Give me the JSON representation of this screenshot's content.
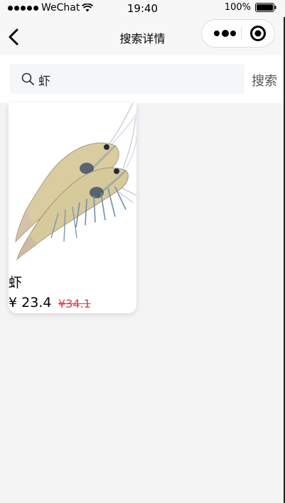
{
  "status_bar": {
    "carrier": "WeChat",
    "time": "19:40",
    "battery": "100%"
  },
  "nav": {
    "title": "搜索详情"
  },
  "search": {
    "query": "虾",
    "button_label": "搜索"
  },
  "results": [
    {
      "name": "虾",
      "price": "¥ 23.4",
      "old_price": "¥34.1"
    }
  ],
  "colors": {
    "page_bg": "#f4f4f4",
    "old_price": "#e23a4e"
  },
  "icons": [
    "signal-dots-icon",
    "wifi-icon",
    "battery-icon",
    "back-arrow-icon",
    "more-dots-icon",
    "close-circle-icon",
    "search-icon"
  ]
}
